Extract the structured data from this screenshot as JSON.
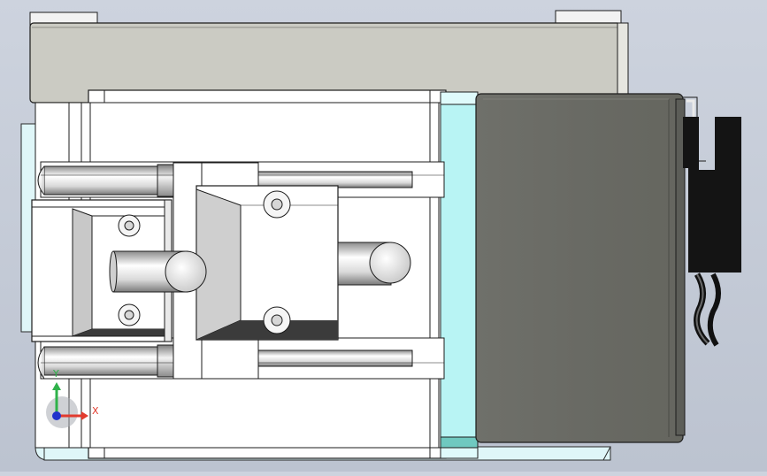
{
  "viewport": {
    "background_top": "#cdd3de",
    "background_bottom": "#bcc3d0"
  },
  "model": {
    "body_color": "#ffffff",
    "outline_color": "#1c1c1c",
    "lid_color": "#cbcbc3",
    "motor_color": "#6b6c66",
    "coupler_color": "#b8f4f4",
    "connector_color": "#141414",
    "accent_light_blue": "#dff6f8",
    "shadow_color": "#3b3b3b"
  },
  "triad": {
    "x_label": "X",
    "y_label": "Y",
    "x_color": "#e23b2e",
    "y_color": "#2fb24a",
    "z_color": "#2233cc"
  }
}
